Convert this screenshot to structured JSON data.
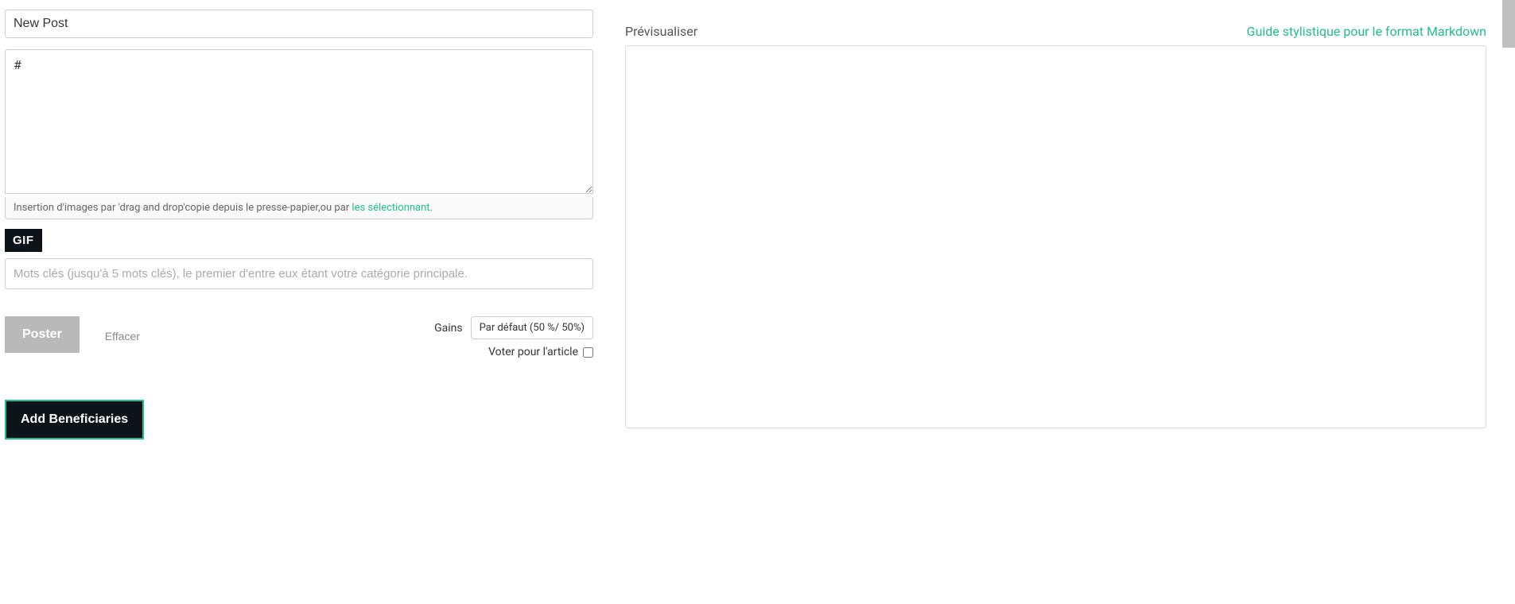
{
  "editor": {
    "title_value": "New Post",
    "body_value": "#",
    "image_hint_prefix": "Insertion d'images par 'drag and drop'copie depuis le presse-papier,ou par ",
    "image_hint_link": "les sélectionnant",
    "image_hint_suffix": ".",
    "gif_button": "GIF",
    "tags_placeholder": "Mots clés (jusqu'à 5 mots clés), le premier d'entre eux étant votre catégorie principale."
  },
  "actions": {
    "post_label": "Poster",
    "clear_label": "Effacer",
    "gains_label": "Gains",
    "gains_value": "Par défaut (50 %/ 50%)",
    "vote_label": "Voter pour l'article",
    "add_beneficiaries": "Add Beneficiaries"
  },
  "preview": {
    "label": "Prévisualiser",
    "style_guide": "Guide stylistique pour le format Markdown"
  }
}
